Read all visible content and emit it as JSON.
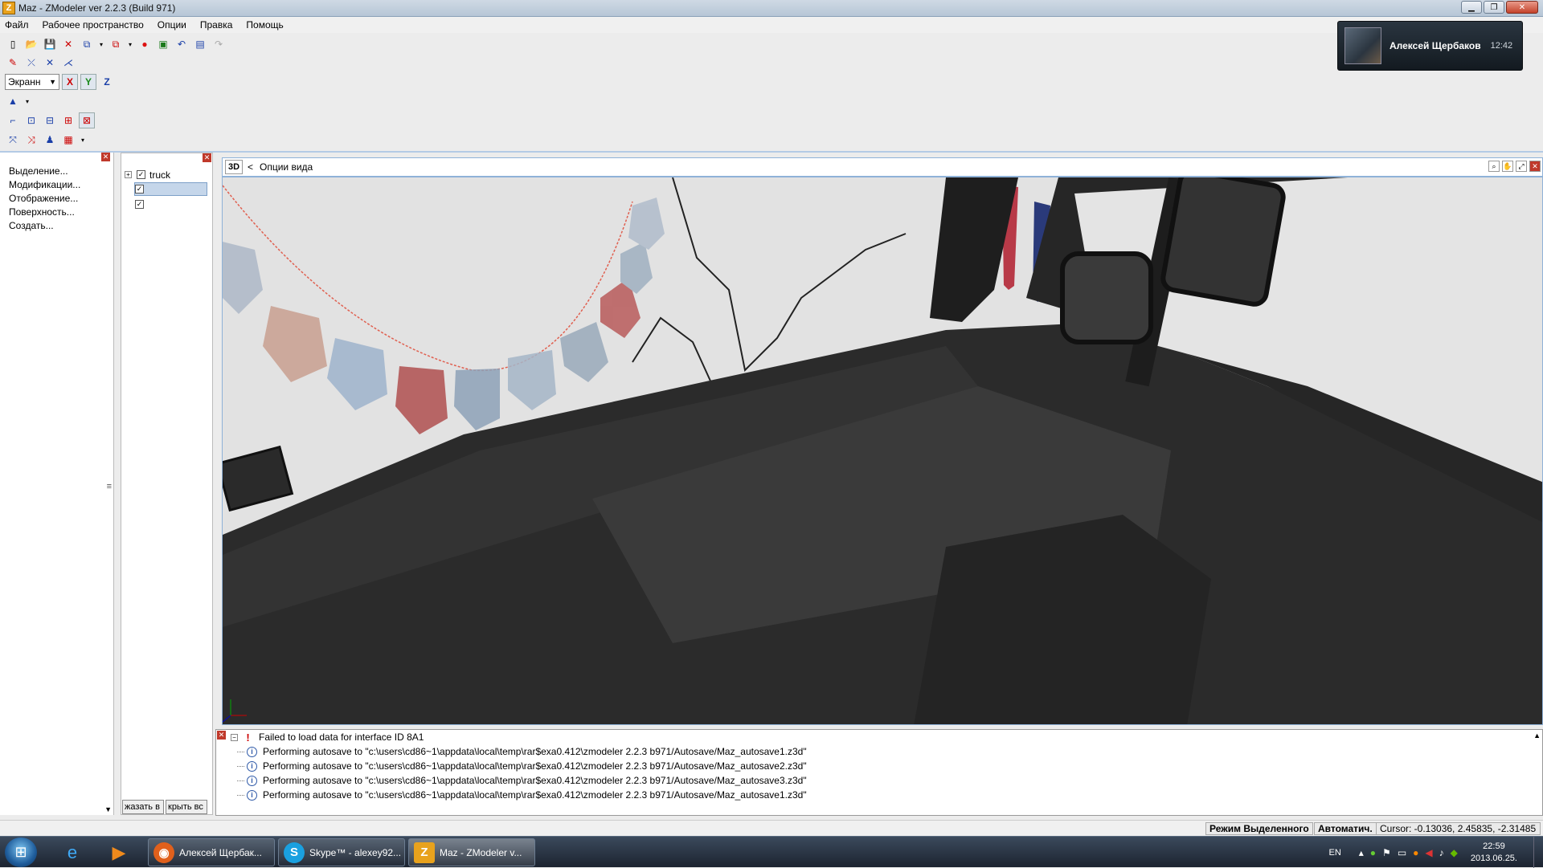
{
  "window": {
    "title": "Maz - ZModeler ver 2.2.3 (Build 971)",
    "app_icon": "Z"
  },
  "menu": [
    "Файл",
    "Рабочее пространство",
    "Опции",
    "Правка",
    "Помощь"
  ],
  "toolbar": {
    "coord_mode": "Экранн",
    "axis_x": "X",
    "axis_y": "Y",
    "axis_z": "Z"
  },
  "notification": {
    "name": "Алексей Щербаков",
    "time": "12:42"
  },
  "left_panel": {
    "items": [
      "Выделение...",
      "Модификации...",
      "Отображение...",
      "Поверхность...",
      "Создать..."
    ]
  },
  "tree": {
    "root_label": "truck",
    "show_button": "жазать в",
    "hide_button": "крыть вс"
  },
  "viewport": {
    "mode_label": "3D",
    "options_label": "Опции вида",
    "back_arrow": "<"
  },
  "log": {
    "lines": [
      {
        "type": "error",
        "text": "Failed to load data for interface ID 8A1"
      },
      {
        "type": "info",
        "text": "Performing autosave to \"c:\\users\\cd86~1\\appdata\\local\\temp\\rar$exa0.412\\zmodeler 2.2.3 b971/Autosave/Maz_autosave1.z3d\""
      },
      {
        "type": "info",
        "text": "Performing autosave to \"c:\\users\\cd86~1\\appdata\\local\\temp\\rar$exa0.412\\zmodeler 2.2.3 b971/Autosave/Maz_autosave2.z3d\""
      },
      {
        "type": "info",
        "text": "Performing autosave to \"c:\\users\\cd86~1\\appdata\\local\\temp\\rar$exa0.412\\zmodeler 2.2.3 b971/Autosave/Maz_autosave3.z3d\""
      },
      {
        "type": "info",
        "text": "Performing autosave to \"c:\\users\\cd86~1\\appdata\\local\\temp\\rar$exa0.412\\zmodeler 2.2.3 b971/Autosave/Maz_autosave1.z3d\""
      }
    ]
  },
  "status": {
    "mode": "Режим Выделенного",
    "auto": "Автоматич.",
    "cursor": "Cursor: -0.13036, 2.45835, -2.31485"
  },
  "taskbar": {
    "tasks": [
      {
        "label": "Алексей Щербак...",
        "icon": "firefox-icon",
        "color": "#e0601c"
      },
      {
        "label": "Skype™ - alexey92...",
        "icon": "skype-icon",
        "color": "#1aa0e0"
      },
      {
        "label": "Maz - ZModeler v...",
        "icon": "zmodeler-icon",
        "color": "#e8a21d"
      }
    ],
    "lang": "EN",
    "time": "22:59",
    "date": "2013.06.25."
  }
}
